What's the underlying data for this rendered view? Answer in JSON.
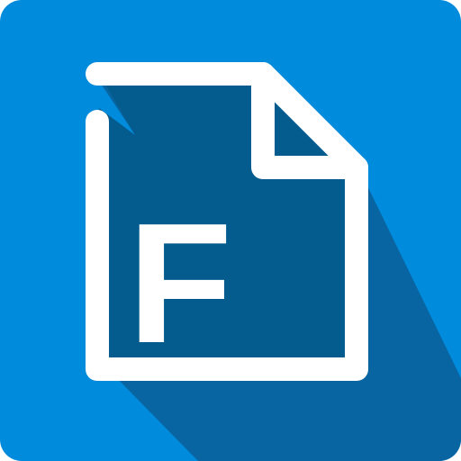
{
  "app_icon": {
    "letter": "F",
    "background_color": "#008BDC",
    "shadow_color": "#0A5E96",
    "page_fill_color": "#045C8E",
    "stroke_color": "#FFFFFF",
    "icon_name": "file-document-icon"
  }
}
